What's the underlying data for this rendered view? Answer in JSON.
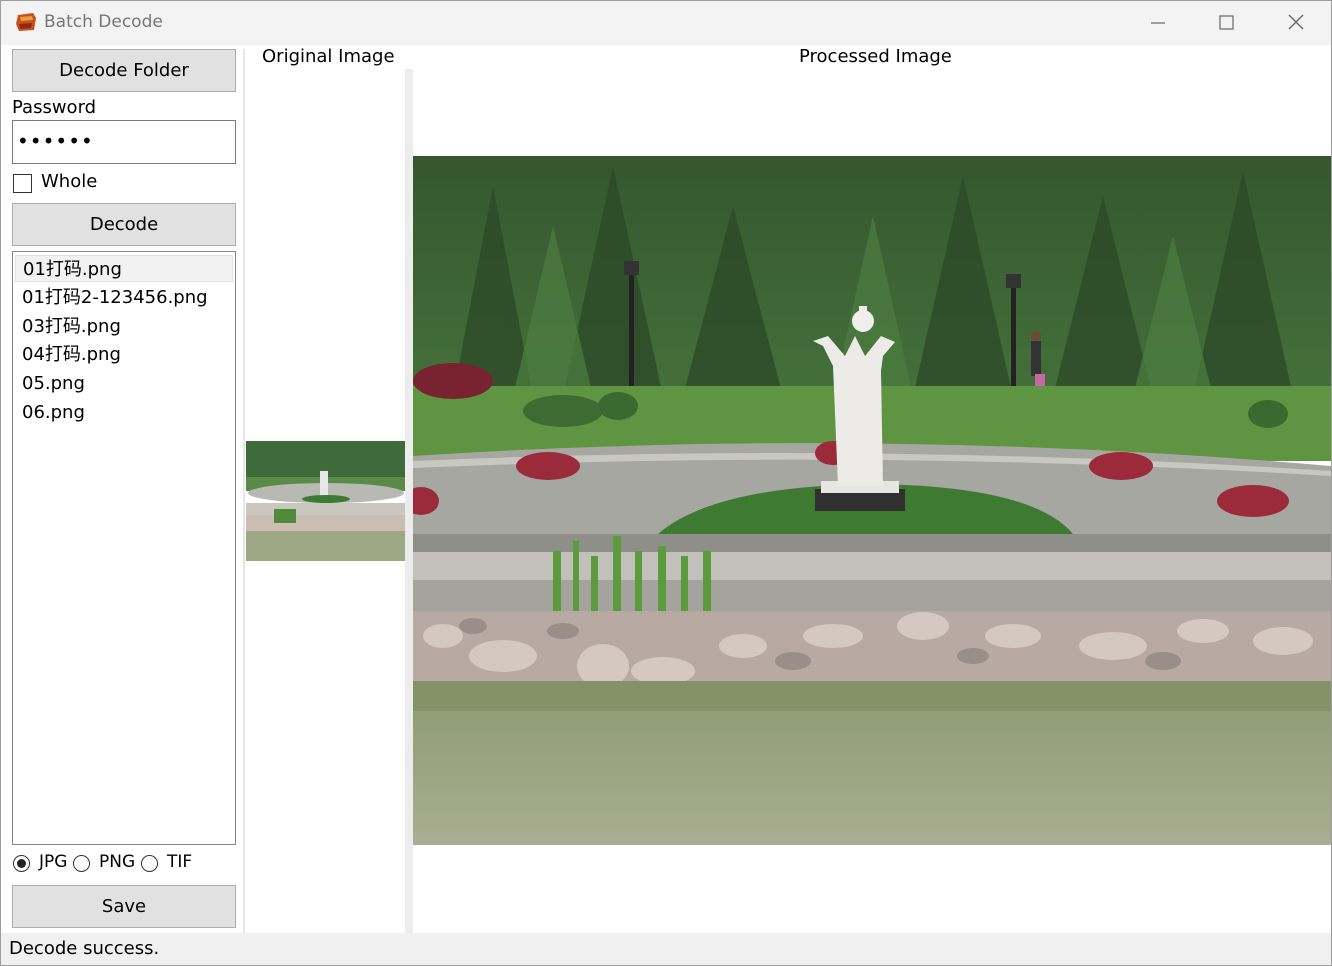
{
  "window": {
    "title": "Batch Decode"
  },
  "sidebar": {
    "decode_folder_label": "Decode Folder",
    "password_label": "Password",
    "password_value": "••••••",
    "whole_label": "Whole",
    "whole_checked": false,
    "decode_label": "Decode",
    "files": [
      {
        "name": "01打码.png",
        "selected": true
      },
      {
        "name": "01打码2-123456.png",
        "selected": false
      },
      {
        "name": "03打码.png",
        "selected": false
      },
      {
        "name": "04打码.png",
        "selected": false
      },
      {
        "name": "05.png",
        "selected": false
      },
      {
        "name": "06.png",
        "selected": false
      }
    ],
    "formats": [
      {
        "label": "JPG",
        "selected": true
      },
      {
        "label": "PNG",
        "selected": false
      },
      {
        "label": "TIF",
        "selected": false
      }
    ],
    "save_label": "Save"
  },
  "panels": {
    "original_title": "Original Image",
    "processed_title": "Processed Image"
  },
  "status": {
    "text": "Decode success."
  },
  "colors": {
    "button_bg": "#e1e1e1",
    "titlebar_bg": "#f3f3f3",
    "status_bg": "#f0f0f0"
  }
}
